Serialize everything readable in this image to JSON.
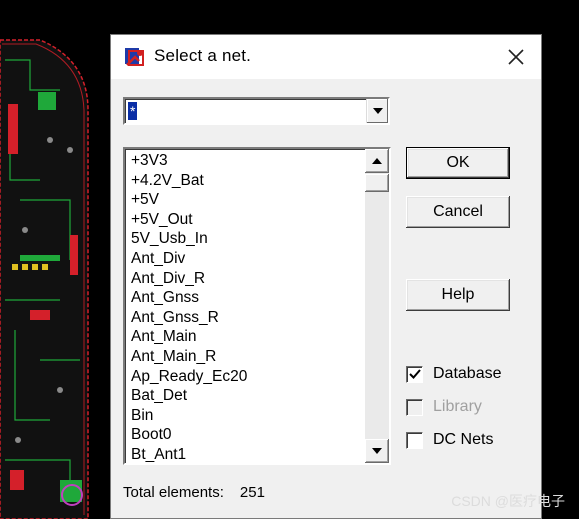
{
  "window": {
    "title": "Select a net."
  },
  "combo": {
    "value": "*"
  },
  "net_list": {
    "items": [
      "+3V3",
      "+4.2V_Bat",
      "+5V",
      "+5V_Out",
      "5V_Usb_In",
      "Ant_Div",
      "Ant_Div_R",
      "Ant_Gnss",
      "Ant_Gnss_R",
      "Ant_Main",
      "Ant_Main_R",
      "Ap_Ready_Ec20",
      "Bat_Det",
      "Bin",
      "Boot0",
      "Bt_Ant1"
    ]
  },
  "buttons": {
    "ok": "OK",
    "cancel": "Cancel",
    "help": "Help"
  },
  "options": {
    "database": {
      "label": "Database",
      "checked": true,
      "enabled": true
    },
    "library": {
      "label": "Library",
      "checked": false,
      "enabled": false
    },
    "dc_nets": {
      "label": "DC Nets",
      "checked": false,
      "enabled": true
    }
  },
  "footer": {
    "total_label": "Total elements:",
    "total_count": "251"
  },
  "watermark": "CSDN @医疗电子",
  "colors": {
    "selection": "#0a2ea6",
    "dialog_bg": "#f0f0f0",
    "pcb_outline": "#d4202a",
    "pcb_traces": "#1fa83a"
  }
}
